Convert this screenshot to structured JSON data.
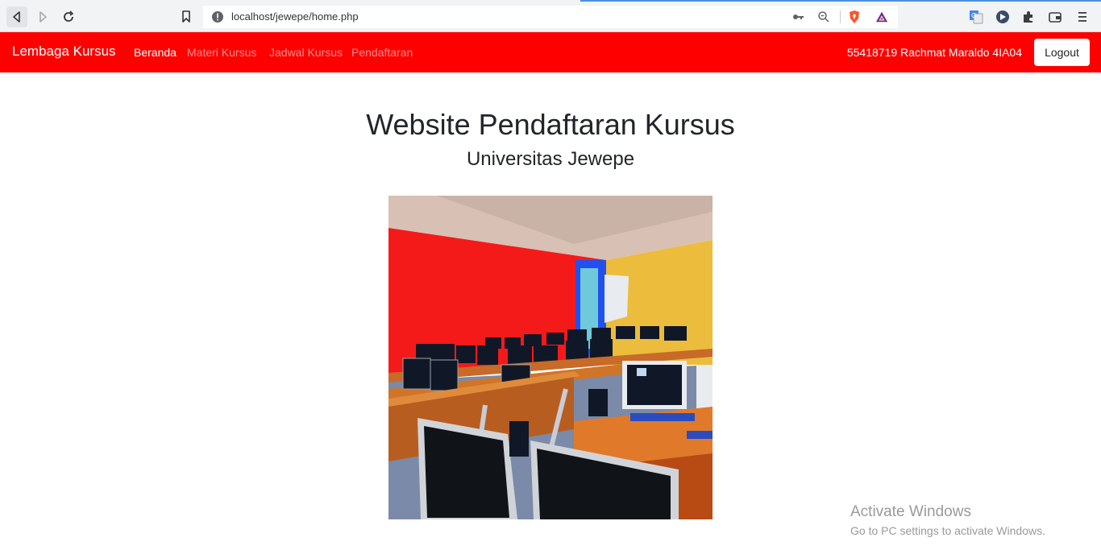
{
  "browser": {
    "url": "localhost/jewepe/home.php"
  },
  "navbar": {
    "brand": "Lembaga Kursus",
    "links": [
      {
        "label": "Beranda",
        "active": true
      },
      {
        "label": "Materi Kursus",
        "active": false
      },
      {
        "label": "Jadwal Kursus",
        "active": false
      },
      {
        "label": "Pendaftaran",
        "active": false
      }
    ],
    "user": "55418719 Rachmat Maraldo 4IA04",
    "logout_label": "Logout",
    "color": "#ff0000"
  },
  "main": {
    "title": "Website Pendaftaran Kursus",
    "subtitle": "Universitas Jewepe",
    "image_icon": "computer-lab-photo"
  },
  "watermark": {
    "line1": "Activate Windows",
    "line2": "Go to PC settings to activate Windows."
  }
}
